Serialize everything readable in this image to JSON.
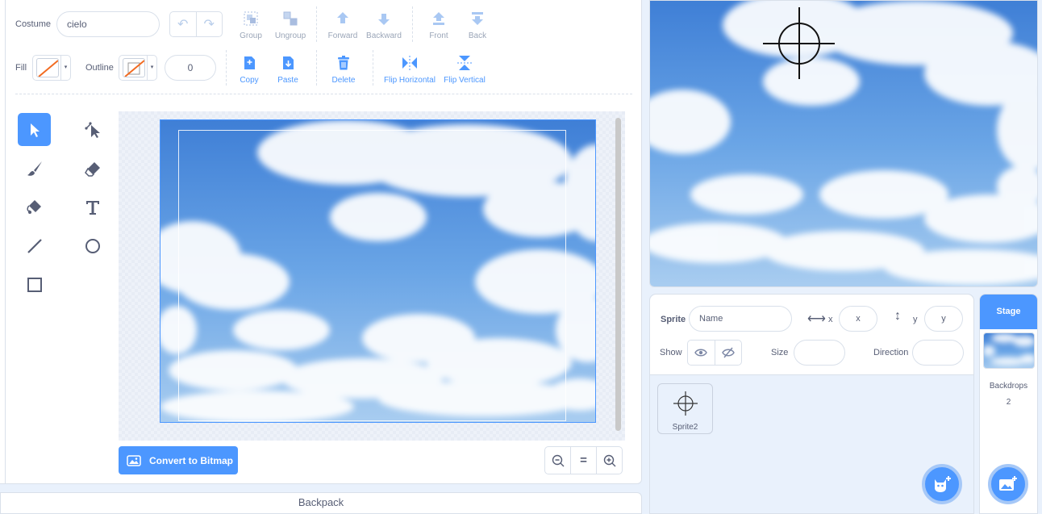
{
  "editor": {
    "costume_label": "Costume",
    "costume_name": "cielo",
    "toolbar": {
      "group": "Group",
      "ungroup": "Ungroup",
      "forward": "Forward",
      "backward": "Backward",
      "front": "Front",
      "back": "Back",
      "copy": "Copy",
      "paste": "Paste",
      "delete": "Delete",
      "flip_horizontal": "Flip Horizontal",
      "flip_vertical": "Flip Vertical"
    },
    "fill_label": "Fill",
    "outline_label": "Outline",
    "outline_width": "0",
    "convert_button": "Convert to Bitmap",
    "zoom_reset": "="
  },
  "backpack": {
    "label": "Backpack"
  },
  "sprite_info": {
    "sprite_label": "Sprite",
    "name_placeholder": "Name",
    "x_label": "x",
    "x_placeholder": "x",
    "y_label": "y",
    "y_placeholder": "y",
    "show_label": "Show",
    "size_label": "Size",
    "direction_label": "Direction"
  },
  "sprites": [
    {
      "name": "Sprite2"
    }
  ],
  "stage_selector": {
    "header": "Stage",
    "backdrops_label": "Backdrops",
    "backdrops_count": "2"
  },
  "colors": {
    "accent": "#4c97ff",
    "text": "#575e75",
    "border": "#d9e0ea",
    "background": "#e9f1fc"
  }
}
